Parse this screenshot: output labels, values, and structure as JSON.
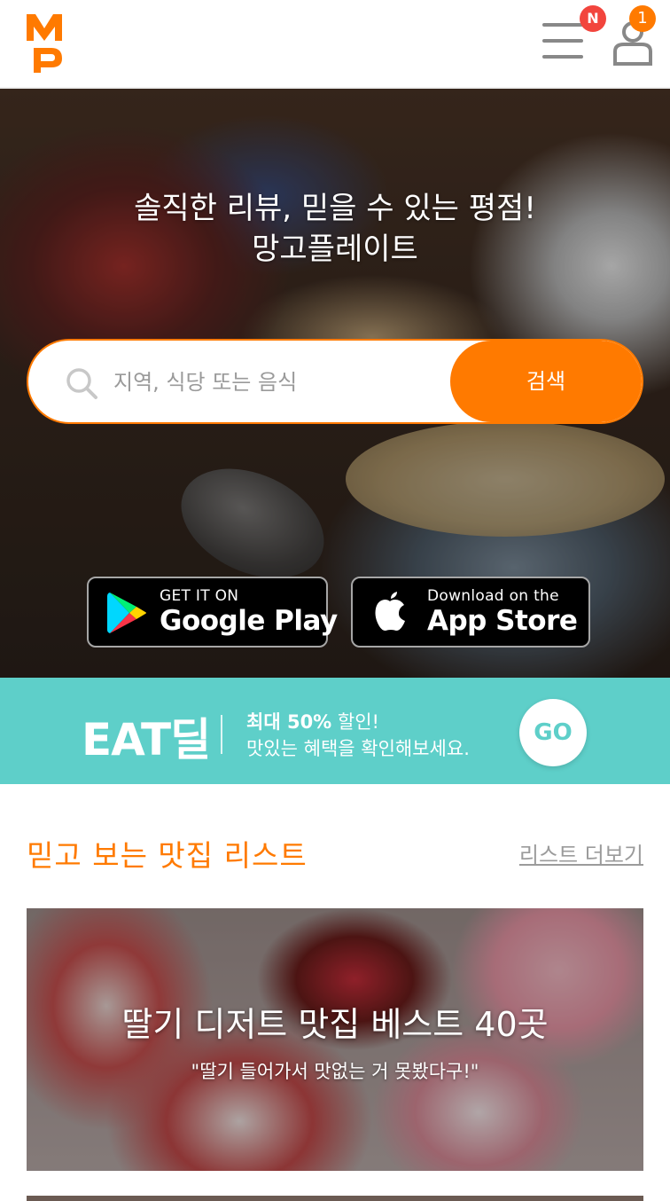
{
  "header": {
    "logo_text": "MP",
    "menu_badge": "N",
    "user_badge": "1"
  },
  "hero": {
    "title_line1": "솔직한 리뷰, 믿을 수 있는 평점!",
    "title_line2": "망고플레이트",
    "search": {
      "placeholder": "지역, 식당 또는 음식",
      "button_label": "검색"
    },
    "google_play": {
      "small": "GET IT ON",
      "big": "Google Play"
    },
    "app_store": {
      "small": "Download on the",
      "big": "App Store"
    }
  },
  "eat_deal": {
    "logo": "EAT딜",
    "line1_bold": "최대 50%",
    "line1_rest": " 할인!",
    "line2": "맛있는 혜택을 확인해보세요.",
    "go_label": "GO",
    "color": "#5ecfc9"
  },
  "list_section": {
    "title": "믿고 보는 맛집 리스트",
    "more_label": "리스트 더보기",
    "cards": [
      {
        "title": "딸기 디저트 맛집 베스트 40곳",
        "subtitle": "\"딸기 들어가서 맛없는 거 못봤다구!\""
      }
    ]
  },
  "colors": {
    "brand": "#ff7a00",
    "new_badge": "#f2453d",
    "eat_deal": "#5ecfc9"
  }
}
